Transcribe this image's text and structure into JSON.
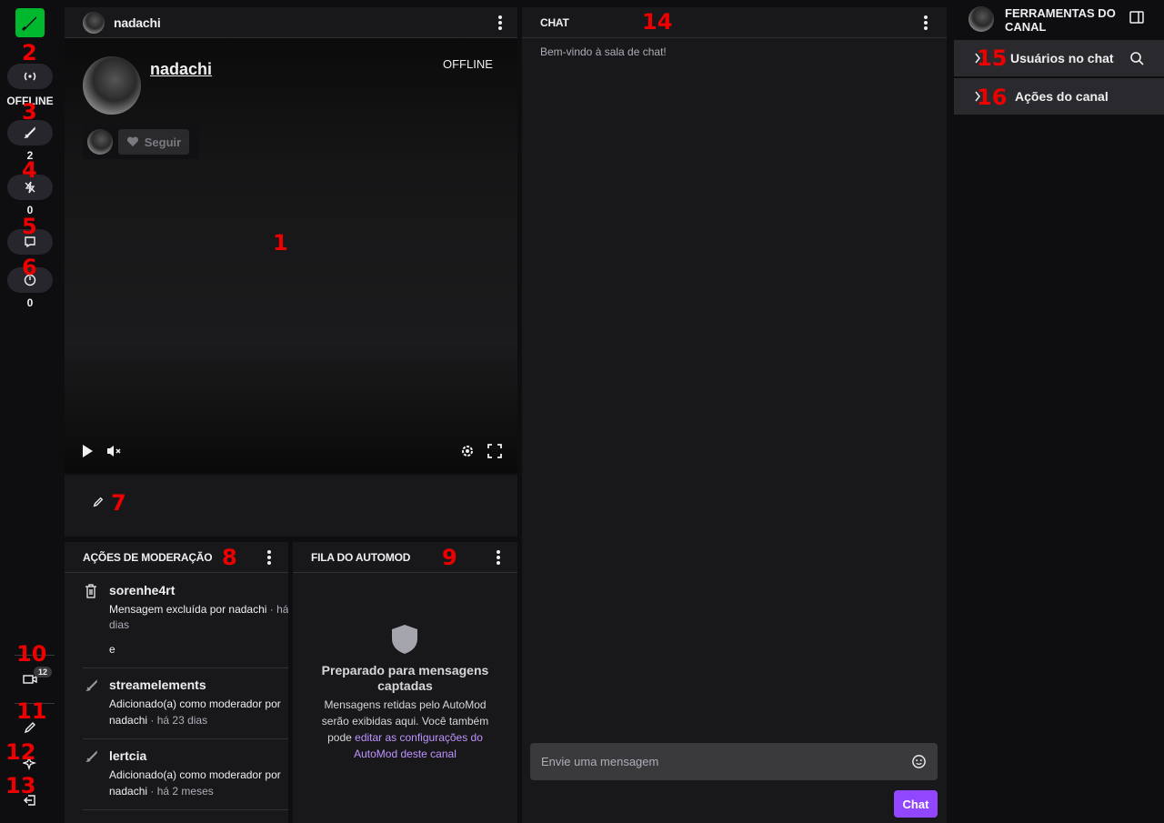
{
  "rail": {
    "status": "OFFLINE",
    "mods_count": "2",
    "vips_count": "0",
    "chatters_count": "0",
    "clips_badge": "12"
  },
  "stream": {
    "header_channel": "nadachi",
    "channel_name": "nadachi",
    "status": "OFFLINE",
    "follow_label": "Seguir"
  },
  "mod_actions": {
    "title": "AÇÕES DE MODERAÇÃO",
    "items": [
      {
        "user": "sorenhe4rt",
        "text": "Mensagem excluída por nadachi",
        "time": "· há",
        "time2": "dias",
        "extra": "e"
      },
      {
        "user": "streamelements",
        "text": "Adicionado(a) como moderador por",
        "by": "nadachi",
        "time": "· há 23 dias"
      },
      {
        "user": "lertcia",
        "text": "Adicionado(a) como moderador por",
        "by": "nadachi",
        "time": "· há 2 meses"
      }
    ]
  },
  "automod": {
    "title": "FILA DO AUTOMOD",
    "heading": "Preparado para mensagens captadas",
    "body": "Mensagens retidas pelo AutoMod serão exibidas aqui. Você também pode",
    "link": "editar as configurações do AutoMod deste canal"
  },
  "chat": {
    "title": "CHAT",
    "welcome": "Bem-vindo à sala de chat!",
    "input_placeholder": "Envie uma mensagem",
    "send_label": "Chat"
  },
  "tools": {
    "title": "FERRAMENTAS DO CANAL",
    "users_in_chat": "Usuários no chat",
    "channel_actions": "Ações do canal"
  },
  "annotations": [
    "1",
    "2",
    "3",
    "4",
    "5",
    "6",
    "7",
    "8",
    "9",
    "10",
    "11",
    "12",
    "13",
    "14",
    "15",
    "16"
  ],
  "colors": {
    "accent": "#9147ff",
    "logo": "#00b82e",
    "annotation": "#ee0000"
  }
}
